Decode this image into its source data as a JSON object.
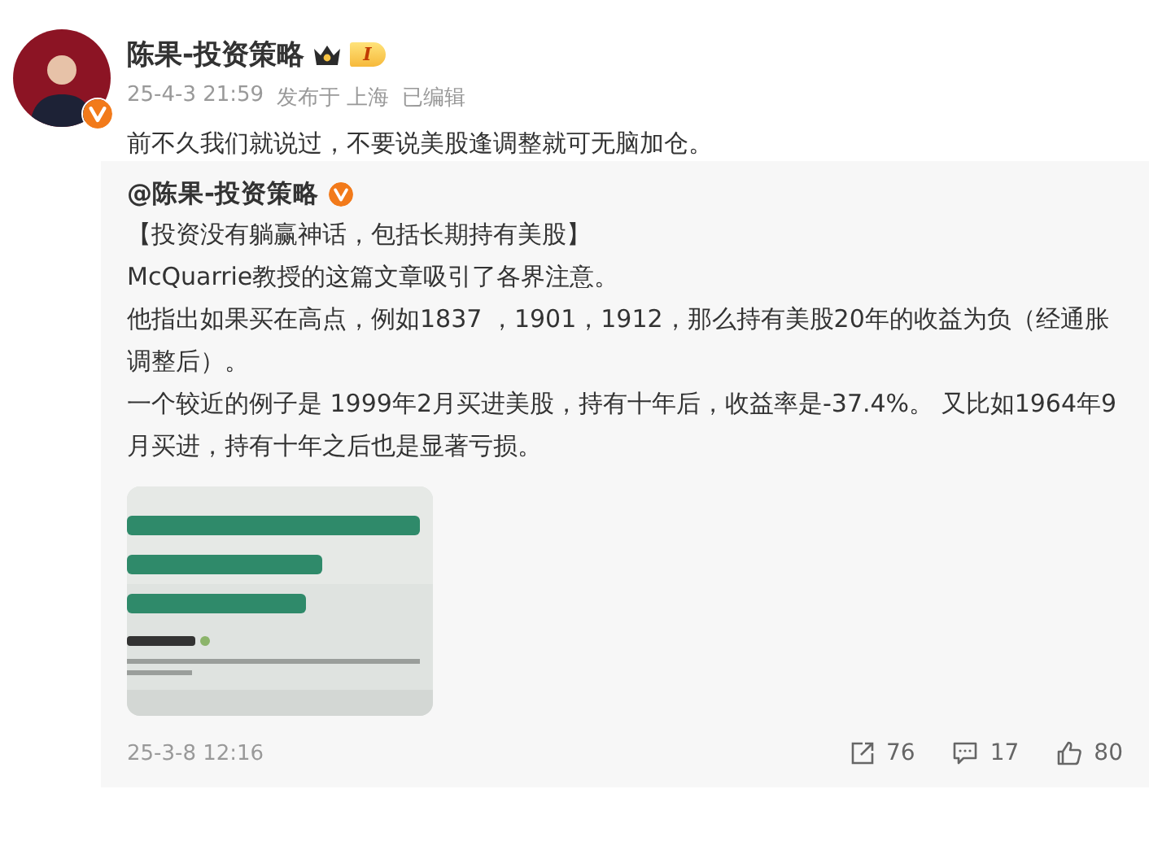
{
  "post": {
    "author": "陈果-投资策略",
    "verified": true,
    "member_level": "I",
    "time": "25-4-3 21:59",
    "source": "发布于 上海",
    "edited": "已编辑",
    "text": "前不久我们就说过，不要说美股逢调整就可无脑加仓。"
  },
  "repost": {
    "author": "@陈果-投资策略",
    "verified": true,
    "paragraphs": [
      "【投资没有躺赢神话，包括长期持有美股】",
      "McQuarrie教授的这篇文章吸引了各界注意。",
      "他指出如果买在高点，例如1837 ，1901，1912，那么持有美股20年的收益为负（经通胀调整后）。",
      "一个较近的例子是 1999年2月买进美股，持有十年后，收益率是-37.4%。 又比如1964年9月买进，持有十年之后也是显著亏损。"
    ],
    "time": "25-3-8 12:16",
    "actions": [
      {
        "kind": "share",
        "count": "76"
      },
      {
        "kind": "comment",
        "count": "17"
      },
      {
        "kind": "like",
        "count": "80"
      }
    ]
  }
}
